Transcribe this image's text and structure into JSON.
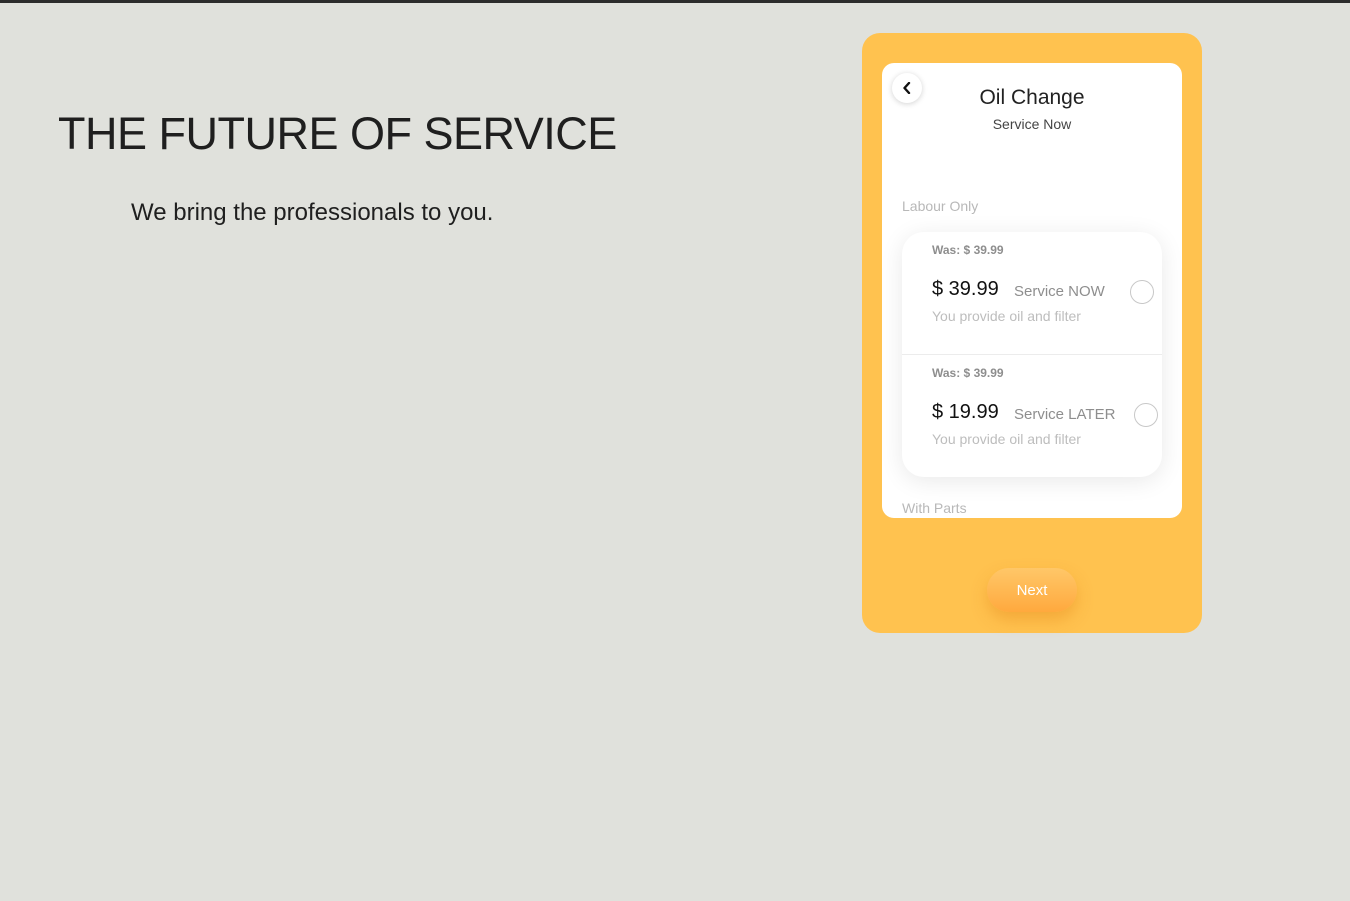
{
  "hero": {
    "title": "THE FUTURE OF SERVICE",
    "subtitle": "We bring the professionals to you."
  },
  "app": {
    "title": "Oil Change",
    "subtitle": "Service Now",
    "back_icon": "chevron-left-icon",
    "sections": {
      "labour": "Labour Only",
      "parts": "With Parts"
    },
    "options": [
      {
        "was": "Was: $ 39.99",
        "price": "$ 39.99",
        "service": "Service NOW",
        "note": "You provide oil and filter",
        "selected": false
      },
      {
        "was": "Was: $ 39.99",
        "price": "$ 19.99",
        "service": "Service LATER",
        "note": "You provide oil and filter",
        "selected": false
      }
    ],
    "next_label": "Next"
  },
  "colors": {
    "page_background": "#e0e1dc",
    "phone_frame": "#ffc24f",
    "next_button": "#ffb04a"
  }
}
